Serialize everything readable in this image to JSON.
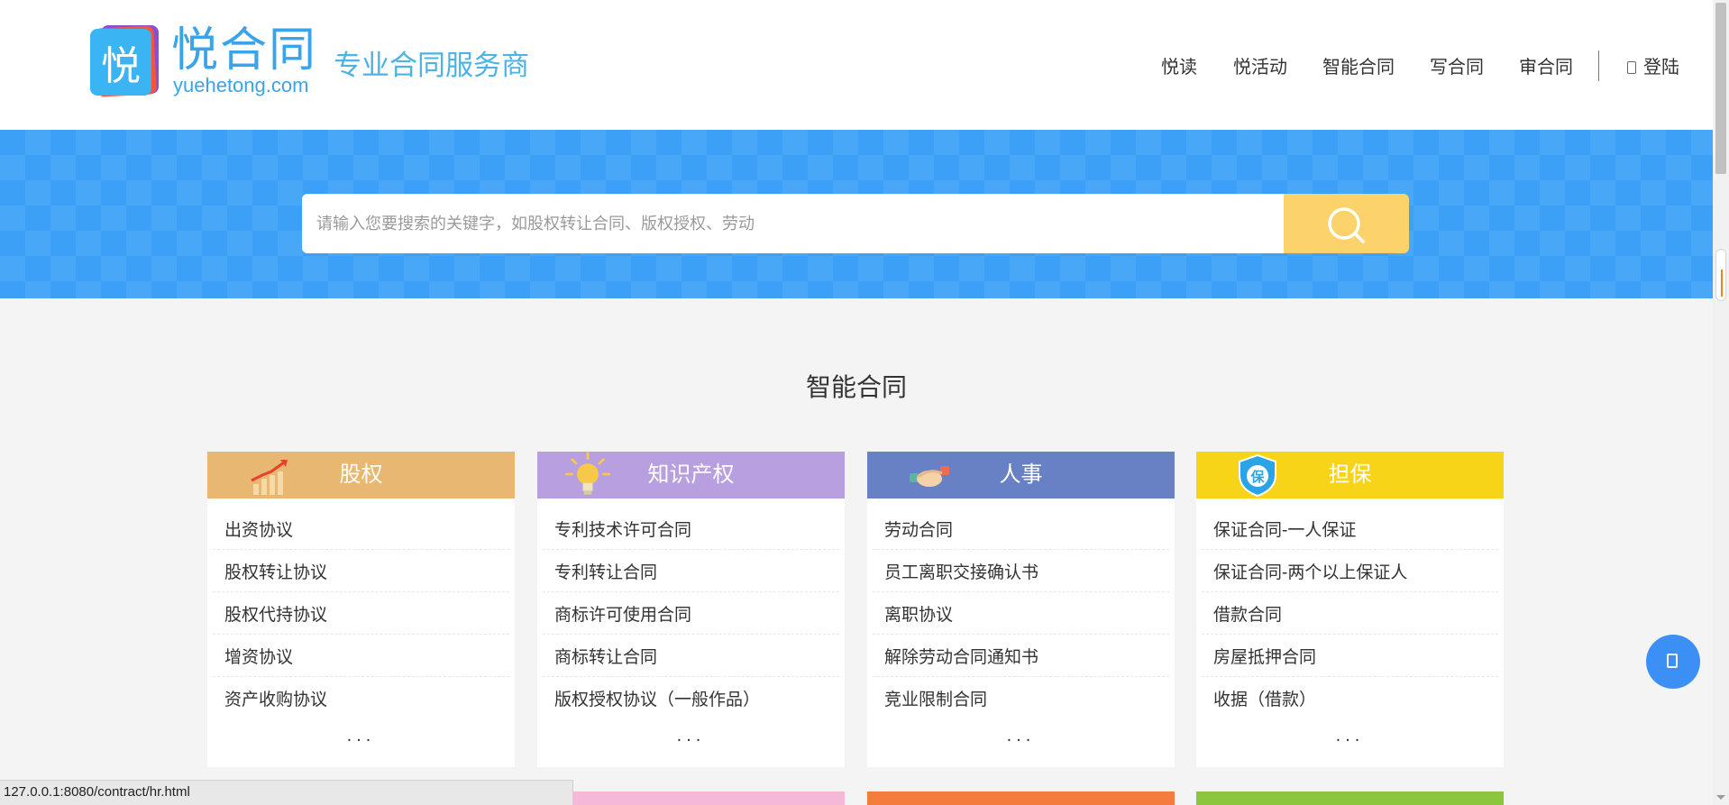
{
  "header": {
    "logo_text": "悦合同",
    "logo_badge_char": "悦",
    "logo_domain": "yuehetong.com",
    "slogan": "专业合同服务商",
    "nav": [
      {
        "label": "悦读"
      },
      {
        "label": "悦活动"
      },
      {
        "label": "智能合同"
      },
      {
        "label": "写合同"
      },
      {
        "label": "审合同"
      }
    ],
    "login_label": "登陆",
    "login_icon": "user-icon"
  },
  "search": {
    "placeholder": "请输入您要搜索的关键字，如股权转让合同、版权授权、劳动",
    "button_icon": "search-icon"
  },
  "section": {
    "title": "智能合同"
  },
  "categories": [
    {
      "title": "股权",
      "color": "#e8b872",
      "icon": "growth-chart-icon",
      "items": [
        "出资协议",
        "股权转让协议",
        "股权代持协议",
        "增资协议",
        "资产收购协议"
      ],
      "more": "..."
    },
    {
      "title": "知识产权",
      "color": "#b89fdf",
      "icon": "lightbulb-icon",
      "items": [
        "专利技术许可合同",
        "专利转让合同",
        "商标许可使用合同",
        "商标转让合同",
        "版权授权协议（一般作品）"
      ],
      "more": "..."
    },
    {
      "title": "人事",
      "color": "#6781c4",
      "icon": "handshake-icon",
      "items": [
        "劳动合同",
        "员工离职交接确认书",
        "离职协议",
        "解除劳动合同通知书",
        "竞业限制合同"
      ],
      "more": "..."
    },
    {
      "title": "担保",
      "color": "#f7d418",
      "icon": "shield-icon",
      "icon_text": "保",
      "items": [
        "保证合同-一人保证",
        "保证合同-两个以上保证人",
        "借款合同",
        "房屋抵押合同",
        "收据（借款）"
      ],
      "more": "..."
    }
  ],
  "next_row_colors": [
    "#6b86cf",
    "#f5b8d8",
    "#f47c3c",
    "#8cc63f"
  ],
  "floating_button": {
    "icon": "document-icon"
  },
  "status_bar": {
    "url": "127.0.0.1:8080/contract/hr.html"
  },
  "colors": {
    "brand": "#3ba3e8",
    "banner": "#3ba0f6",
    "search_button": "#fcd36a",
    "page_bg": "#f4f4f4"
  }
}
